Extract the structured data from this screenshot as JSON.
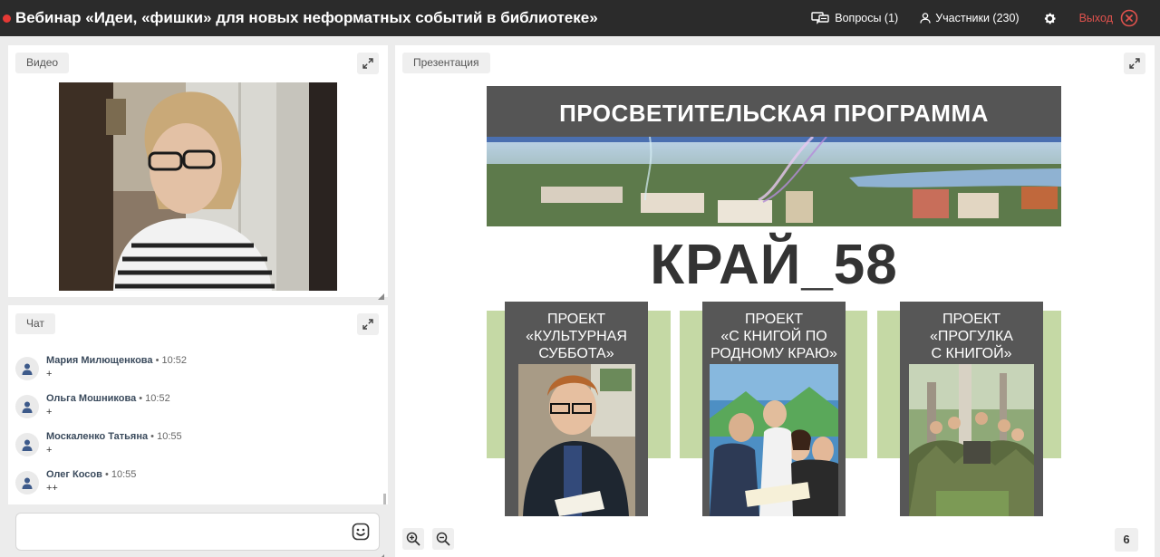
{
  "header": {
    "title": "Вебинар «Идеи, «фишки» для новых неформатных событий в библиотеке»",
    "questions_label": "Вопросы (1)",
    "participants_label": "Участники (230)",
    "exit_label": "Выход"
  },
  "video": {
    "label": "Видео"
  },
  "chat": {
    "label": "Чат",
    "messages": [
      {
        "author": "Мария Милющенкова",
        "time": "10:52",
        "text": "+"
      },
      {
        "author": "Ольга Мошникова",
        "time": "10:52",
        "text": "+"
      },
      {
        "author": "Москаленко Татьяна",
        "time": "10:55",
        "text": "+"
      },
      {
        "author": "Олег Косов",
        "time": "10:55",
        "text": "++"
      }
    ],
    "input_placeholder": ""
  },
  "presentation": {
    "label": "Презентация",
    "page": "6",
    "slide": {
      "header": "ПРОСВЕТИТЕЛЬСКАЯ ПРОГРАММА",
      "big_title": "КРАЙ_58",
      "projects": [
        {
          "line1": "ПРОЕКТ",
          "line2": "«КУЛЬТУРНАЯ",
          "line3": "СУББОТА»"
        },
        {
          "line1": "ПРОЕКТ",
          "line2": "«С КНИГОЙ ПО",
          "line3": "РОДНОМУ КРАЮ»"
        },
        {
          "line1": "ПРОЕКТ",
          "line2": "«ПРОГУЛКА",
          "line3": "С КНИГОЙ»"
        }
      ]
    }
  },
  "colors": {
    "topbar": "#2b2b2b",
    "exit": "#e0524d",
    "record": "#e53935",
    "slide_header": "#555555",
    "slide_green": "#c5d9a5"
  }
}
